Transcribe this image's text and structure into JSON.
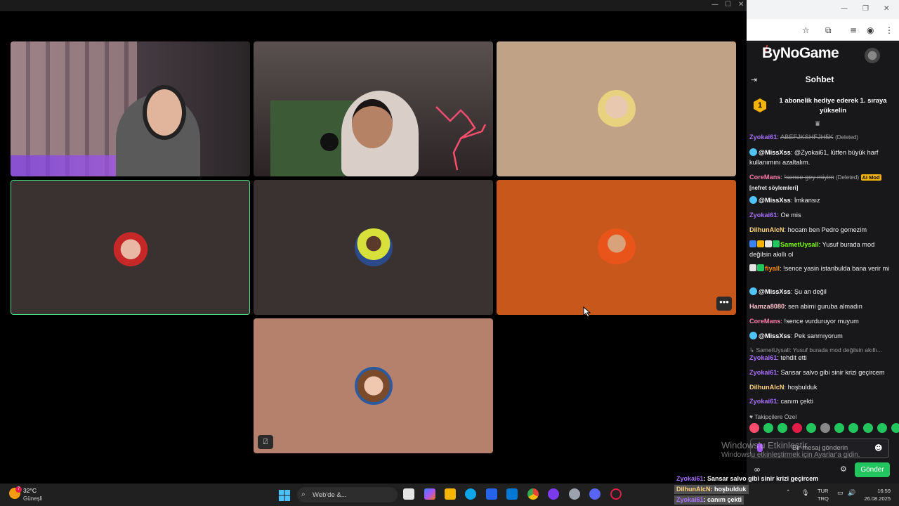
{
  "call": {
    "window_controls": [
      "—",
      "☐",
      "✕"
    ],
    "tiles": [
      {
        "name": "tile-camera-1",
        "bg": "#3a3336"
      },
      {
        "name": "tile-camera-2",
        "bg": "#2e2b2a"
      },
      {
        "name": "tile-avatar-3",
        "bg": "#c0a386"
      },
      {
        "name": "tile-avatar-4",
        "bg": "#3a3131"
      },
      {
        "name": "tile-avatar-5",
        "bg": "#3a3131"
      },
      {
        "name": "tile-avatar-6",
        "bg": "#c8571b"
      },
      {
        "name": "tile-avatar-7",
        "bg": "#b5806c"
      }
    ],
    "more_button": "•••",
    "mute_icon": "⍁"
  },
  "browser": {
    "window_controls": [
      "—",
      "❐",
      "✕"
    ],
    "toolbar_icons": [
      "star-icon",
      "extensions-icon",
      "media-icon",
      "profile-icon",
      "menu-icon"
    ]
  },
  "site": {
    "logo": "ByNoGame",
    "chat_title": "Sohbet",
    "promo_rank": "1",
    "promo_text": "1 abonelik hediye ederek 1. sıraya yükselin"
  },
  "messages": [
    {
      "user": "Zyokai61",
      "color": "#a970ff",
      "text": "ABEFJKSHFJH5K",
      "deleted": true,
      "tag": "(Deleted)"
    },
    {
      "user": "@MissXss",
      "color": "#ffffff",
      "bot": true,
      "text": "@Zyokai61, lütfen büyük harf kullanımını azaltalım."
    },
    {
      "user": "CoreMans",
      "color": "#ff7aa8",
      "text": "!sence gey miyim",
      "deleted": true,
      "tag": "(Deleted)",
      "badge": "AI Mod",
      "extra": "[nefret söylemleri]"
    },
    {
      "user": "@MissXss",
      "color": "#ffffff",
      "bot": true,
      "text": "İmkansız"
    },
    {
      "user": "Zyokai61",
      "color": "#a970ff",
      "text": "Oe mis"
    },
    {
      "user": "DilhunAlcN",
      "color": "#ffd27a",
      "text": "hocam ben Pedro gomezim"
    },
    {
      "user": "SametUysall",
      "color": "#7cfc00",
      "badges": true,
      "text": "Yusuf burada mod değilsin akıllı ol"
    },
    {
      "user": "fiyall",
      "color": "#ff8c00",
      "badges": true,
      "text": "!sence yasin istanbulda bana verir mi"
    },
    {
      "user": "@MissXss",
      "color": "#ffffff",
      "bot": true,
      "text": "Şu an değil"
    },
    {
      "user": "Hamza8080",
      "color": "#ffc0cb",
      "text": "sen abimi guruba almadın"
    },
    {
      "user": "CoreMans",
      "color": "#ff7aa8",
      "text": "!sence vurduruyor muyum"
    },
    {
      "user": "@MissXss",
      "color": "#ffffff",
      "bot": true,
      "text": "Pek sanmıyorum"
    },
    {
      "reply": "↳ SametUysall: Yusuf burada mod değilsin akıllı..."
    },
    {
      "user": "Zyokai61",
      "color": "#a970ff",
      "text": "tehdit etti"
    },
    {
      "user": "Zyokai61",
      "color": "#a970ff",
      "text": "Sansar salvo gibi sinir krizi geçircem"
    },
    {
      "user": "DilhunAlcN",
      "color": "#ffd27a",
      "text": "hoşbulduk"
    },
    {
      "user": "Zyokai61",
      "color": "#a970ff",
      "text": "canım çekti"
    }
  ],
  "followers_label": "♥ Takipçilere Özel",
  "emote_colors": [
    "#ff4d6d",
    "#22c55e",
    "#22c55e",
    "#e11d48",
    "#22c55e",
    "#888888",
    "#22c55e",
    "#22c55e",
    "#22c55e",
    "#22c55e",
    "#22c55e"
  ],
  "chat_input_placeholder": "Bir mesaj gönderin",
  "send_label": "Gönder",
  "watermark": {
    "line1": "Windows'u Etkinleştir",
    "line2": "Windows'u etkinleştirmek için Ayarlar'a gidin."
  },
  "overlay": [
    {
      "user": "Zyokai61",
      "text": ": Sansar salvo gibi sinir krizi geçircem",
      "color": "#a970ff"
    },
    {
      "user": "DilhunAlcN",
      "text": ": hoşbulduk",
      "color": "#ffd27a"
    },
    {
      "user": "Zyokai61",
      "text": ": canım çekti",
      "color": "#a970ff"
    }
  ],
  "taskbar": {
    "weather_badge": "7",
    "temp": "32°C",
    "location": "Güneşli",
    "search_placeholder": "Web'de &...",
    "lang1": "TUR",
    "lang2": "TRQ",
    "time": "16:59",
    "date": "26.08.2025"
  }
}
